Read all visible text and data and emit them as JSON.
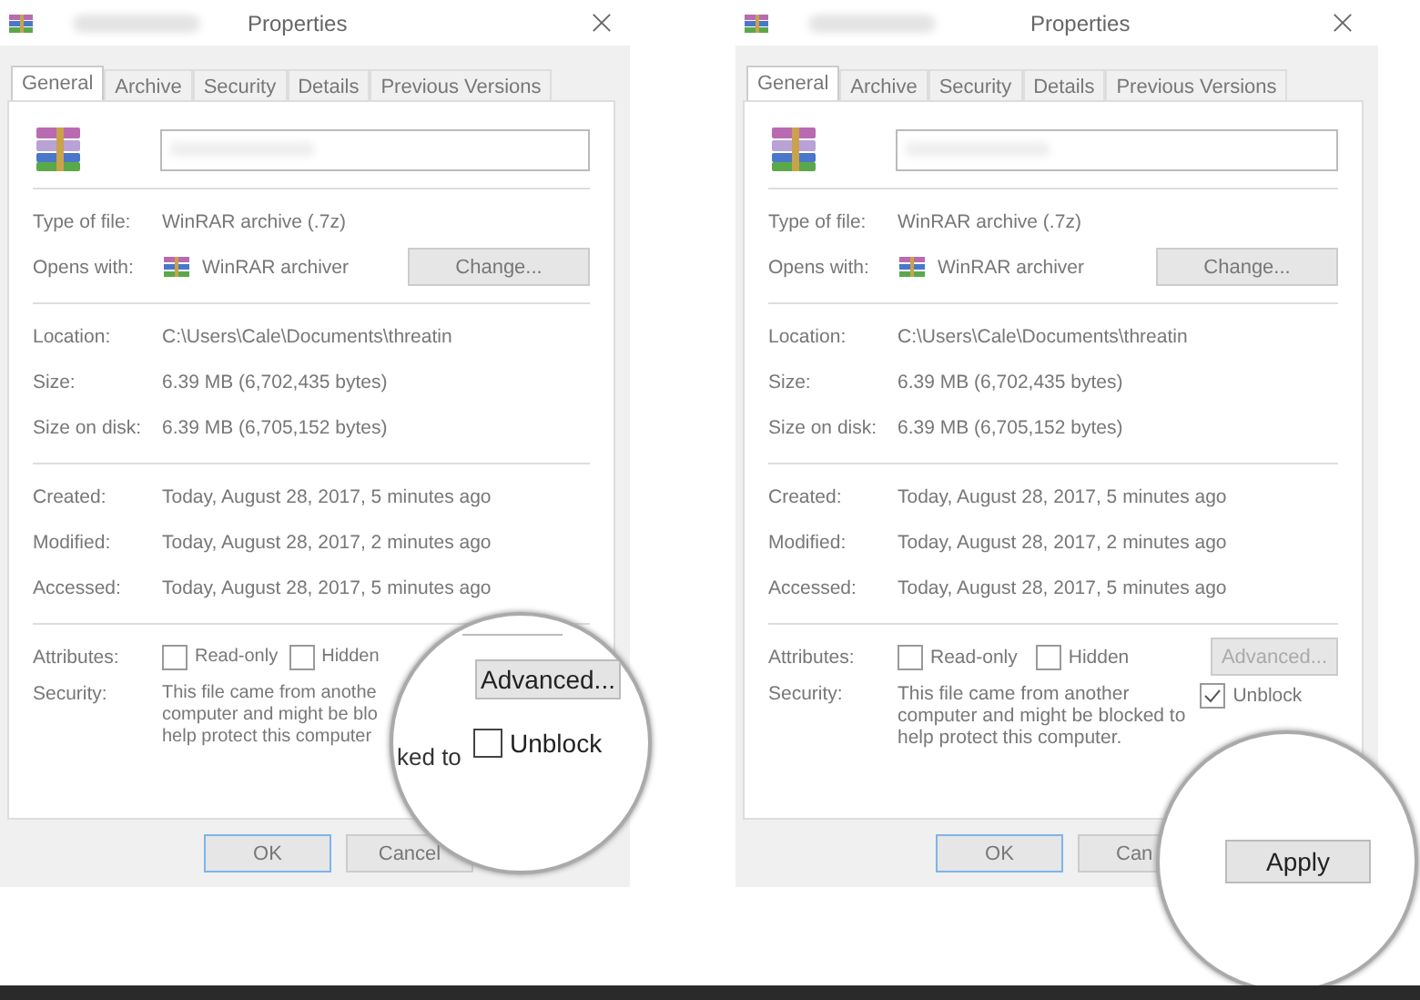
{
  "dialogs": [
    {
      "title": "Properties",
      "tabs": [
        {
          "label": "General",
          "selected": true
        },
        {
          "label": "Archive",
          "selected": false
        },
        {
          "label": "Security",
          "selected": false
        },
        {
          "label": "Details",
          "selected": false
        },
        {
          "label": "Previous Versions",
          "selected": false
        }
      ],
      "sections": [
        [
          {
            "kind": "text",
            "label": "Type of file:",
            "value": "WinRAR archive (.7z)"
          },
          {
            "kind": "app",
            "label": "Opens with:",
            "value": "WinRAR archiver",
            "button": "Change..."
          }
        ],
        [
          {
            "kind": "text",
            "label": "Location:",
            "value": "C:\\Users\\Cale\\Documents\\threatin"
          },
          {
            "kind": "text",
            "label": "Size:",
            "value": "6.39 MB (6,702,435 bytes)"
          },
          {
            "kind": "text",
            "label": "Size on disk:",
            "value": "6.39 MB (6,705,152 bytes)"
          }
        ],
        [
          {
            "kind": "text",
            "label": "Created:",
            "value": "Today, August 28, 2017, 5 minutes ago"
          },
          {
            "kind": "text",
            "label": "Modified:",
            "value": "Today, August 28, 2017, 2 minutes ago"
          },
          {
            "kind": "text",
            "label": "Accessed:",
            "value": "Today, August 28, 2017, 5 minutes ago"
          }
        ]
      ],
      "attributes": {
        "label": "Attributes:",
        "options": [
          {
            "label": "Read-only",
            "checked": false
          },
          {
            "label": "Hidden",
            "checked": false
          }
        ]
      },
      "security": {
        "label": "Security:",
        "lines": [
          "This file came from anothe",
          "computer and might be blo",
          "help protect this computer"
        ]
      },
      "buttons": [
        {
          "label": "OK",
          "kind": "default"
        },
        {
          "label": "Cancel",
          "kind": "normal"
        }
      ],
      "magnifier": {
        "kind": "advanced-unblock",
        "button": "Advanced...",
        "text": "ked to",
        "unblock": {
          "label": "Unblock",
          "checked": false
        }
      }
    },
    {
      "title": "Properties",
      "tabs": [
        {
          "label": "General",
          "selected": true
        },
        {
          "label": "Archive",
          "selected": false
        },
        {
          "label": "Security",
          "selected": false
        },
        {
          "label": "Details",
          "selected": false
        },
        {
          "label": "Previous Versions",
          "selected": false
        }
      ],
      "sections": [
        [
          {
            "kind": "text",
            "label": "Type of file:",
            "value": "WinRAR archive (.7z)"
          },
          {
            "kind": "app",
            "label": "Opens with:",
            "value": "WinRAR archiver",
            "button": "Change..."
          }
        ],
        [
          {
            "kind": "text",
            "label": "Location:",
            "value": "C:\\Users\\Cale\\Documents\\threatin"
          },
          {
            "kind": "text",
            "label": "Size:",
            "value": "6.39 MB (6,702,435 bytes)"
          },
          {
            "kind": "text",
            "label": "Size on disk:",
            "value": "6.39 MB (6,705,152 bytes)"
          }
        ],
        [
          {
            "kind": "text",
            "label": "Created:",
            "value": "Today, August 28, 2017, 5 minutes ago"
          },
          {
            "kind": "text",
            "label": "Modified:",
            "value": "Today, August 28, 2017, 2 minutes ago"
          },
          {
            "kind": "text",
            "label": "Accessed:",
            "value": "Today, August 28, 2017, 5 minutes ago"
          }
        ]
      ],
      "attributes": {
        "label": "Attributes:",
        "options": [
          {
            "label": "Read-only",
            "checked": false
          },
          {
            "label": "Hidden",
            "checked": false
          }
        ],
        "button": "Advanced..."
      },
      "security": {
        "label": "Security:",
        "lines": [
          "This file came from another",
          "computer and might be blocked to",
          "help protect this computer."
        ],
        "unblock": {
          "label": "Unblock",
          "checked": true
        }
      },
      "buttons": [
        {
          "label": "OK",
          "kind": "default"
        },
        {
          "label": "Can",
          "kind": "partial"
        }
      ],
      "magnifier": {
        "kind": "apply",
        "button": "Apply"
      }
    }
  ]
}
